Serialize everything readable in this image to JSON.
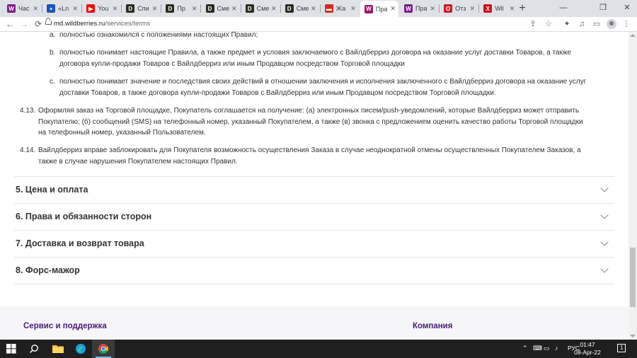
{
  "tabs": [
    {
      "label": "Час",
      "favicon": "wildberries-icon",
      "color": "#7d1d8d",
      "glyph": "W"
    },
    {
      "label": "«Ln",
      "favicon": "plus-circle-icon",
      "color": "#1a56b8",
      "glyph": "+"
    },
    {
      "label": "You",
      "favicon": "youtube-icon",
      "color": "#ff0000",
      "glyph": "▶"
    },
    {
      "label": "Спи",
      "favicon": "d-icon",
      "color": "#2b2b1f",
      "glyph": "D"
    },
    {
      "label": "Пр",
      "favicon": "d-icon",
      "color": "#2b2b1f",
      "glyph": "D"
    },
    {
      "label": "Сме",
      "favicon": "d-icon",
      "color": "#2b2b1f",
      "glyph": "D"
    },
    {
      "label": "Сме",
      "favicon": "d-icon",
      "color": "#2b2b1f",
      "glyph": "D"
    },
    {
      "label": "Сме",
      "favicon": "d-icon",
      "color": "#2b2b1f",
      "glyph": "D"
    },
    {
      "label": "Жа",
      "favicon": "flag-icon",
      "color": "#d52b1e",
      "glyph": "▬"
    },
    {
      "label": "Пра",
      "favicon": "wildberries-icon",
      "color": "#a0136e",
      "glyph": "W",
      "active": true
    },
    {
      "label": "Пра",
      "favicon": "wildberries-icon",
      "color": "#7d1d8d",
      "glyph": "W"
    },
    {
      "label": "Отз",
      "favicon": "opera-icon",
      "color": "#cc1b2b",
      "glyph": "O"
    },
    {
      "label": "Wil",
      "favicon": "xl-icon",
      "color": "#d0111b",
      "glyph": "X"
    }
  ],
  "address": {
    "host": "md.wildberries.ru",
    "path": "/services/terms"
  },
  "content": {
    "item_a_marker": "a.",
    "item_a": "полностью ознакомился с положениями настоящих Правил;",
    "item_b_marker": "b.",
    "item_b_line1": "полностью понимает настоящие Правила, а также предмет и условия заключаемого с Вайлдберриз договора на оказание услуг доставки Товаров, а также",
    "item_b_line2": "договора купли-продажи Товаров с Вайлдберриз или иным Продавцом посредством Торговой площадки",
    "item_c_marker": "c.",
    "item_c_line1": "полностью понимает значение и последствия своих действий в отношении заключения и исполнения заключенного с Вайлдберриз договора на оказание услуг",
    "item_c_line2": "доставки Товаров, а также договора купли-продажи Товаров с Вайлдберриз или иным Продавцом посредством Торговой площадки.",
    "p413_num": "4.13.",
    "p413_line1": "Оформляя заказ на Торговой площадке, Покупатель соглашается на получение: (а) электронных писем/push-уведомлений, которые Вайлдберриз может отправить",
    "p413_line2": "Покупателю; (б) сообщений (SMS) на телефонный номер, указанный Покупателем, а также (в) звонка с предложением оценить качество работы Торговой площадки",
    "p413_line3": "на телефонный номер, указанный Пользователем.",
    "p414_num": "4.14.",
    "p414_line1": "Вайлдберриз вправе заблокировать для Покупателя возможность осуществления Заказа в случае неоднократной отмены осуществленных Покупателем Заказов, а",
    "p414_line2": "также в случае нарушения Покупателем настоящих Правил."
  },
  "sections": [
    {
      "title": "5. Цена и оплата"
    },
    {
      "title": "6. Права и обязанности сторон"
    },
    {
      "title": "7. Доставка и возврат товара"
    },
    {
      "title": "8. Форс-мажор"
    }
  ],
  "footer": {
    "service": "Сервис и поддержка",
    "company": "Компания"
  },
  "taskbar": {
    "lang": "РУС",
    "time": "01:47",
    "date": "08-Apr-22",
    "notifications": "1"
  }
}
